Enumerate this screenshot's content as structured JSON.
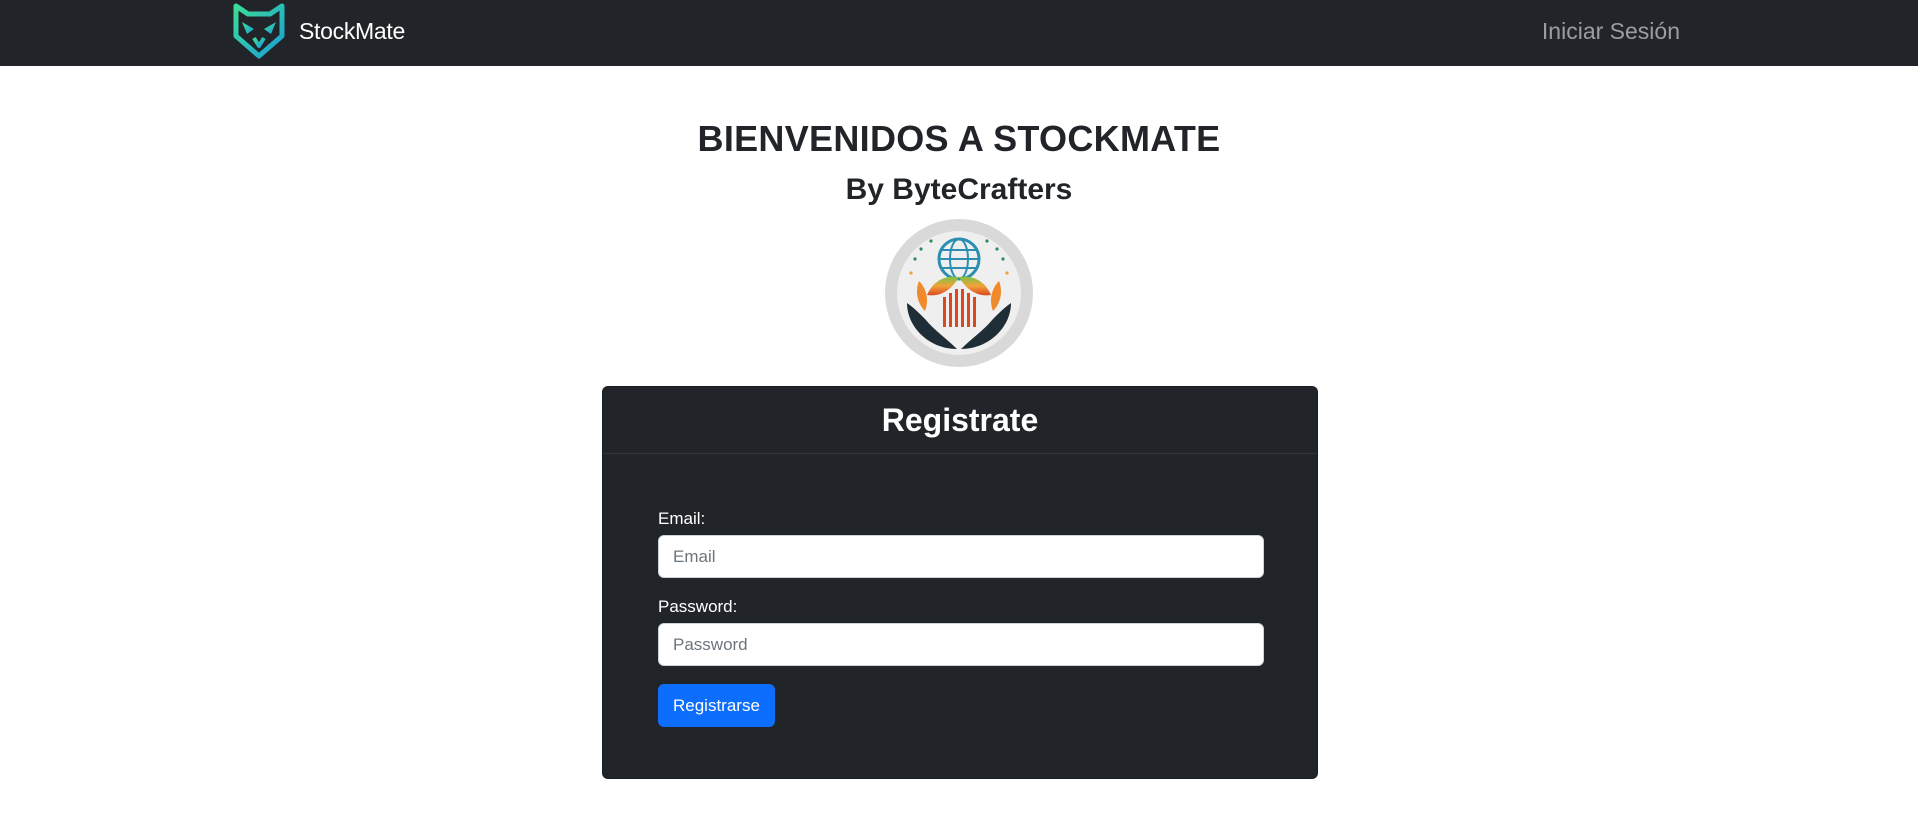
{
  "navbar": {
    "brand_name": "StockMate",
    "brand_icon": "owl-logo-icon",
    "login_link": "Iniciar Sesión",
    "background": "#212529"
  },
  "hero": {
    "title": "BIENVENIDOS A STOCKMATE",
    "subtitle": "By ByteCrafters",
    "emblem_icon": "globe-plant-hands-emblem"
  },
  "register_card": {
    "title": "Registrate",
    "email_label": "Email:",
    "email_placeholder": "Email",
    "email_value": "",
    "password_label": "Password:",
    "password_placeholder": "Password",
    "password_value": "",
    "submit_label": "Registrarse"
  },
  "colors": {
    "primary": "#0d6efd",
    "dark": "#212529",
    "logo_gradient_start": "#3ddc97",
    "logo_gradient_end": "#1a9fd6"
  }
}
